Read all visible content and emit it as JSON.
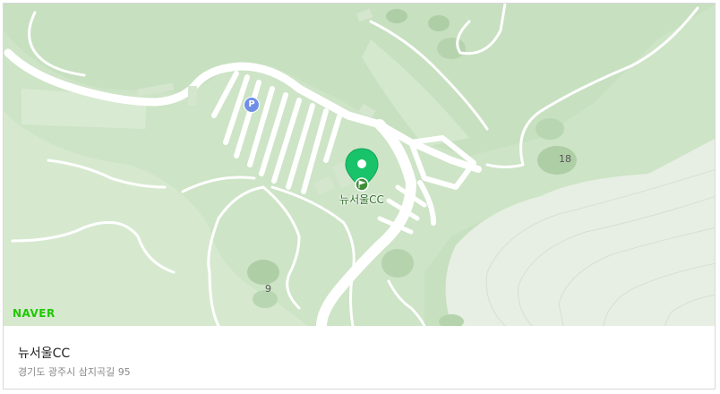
{
  "map": {
    "provider_logo": "NAVER",
    "place_label": "뉴서울CC",
    "parking_symbol": "P",
    "hole_labels": [
      "18",
      "9"
    ],
    "marker_icon": "map-pin-icon",
    "colors": {
      "land": "#c7e0c0",
      "fairway": "#d8ebd2",
      "dark_green": "#aecea6",
      "road": "#ffffff",
      "terrain": "#e6ede2",
      "marker": "#19c36a"
    }
  },
  "place": {
    "title": "뉴서울CC",
    "address": "경기도 광주시 삼지곡길 95"
  }
}
